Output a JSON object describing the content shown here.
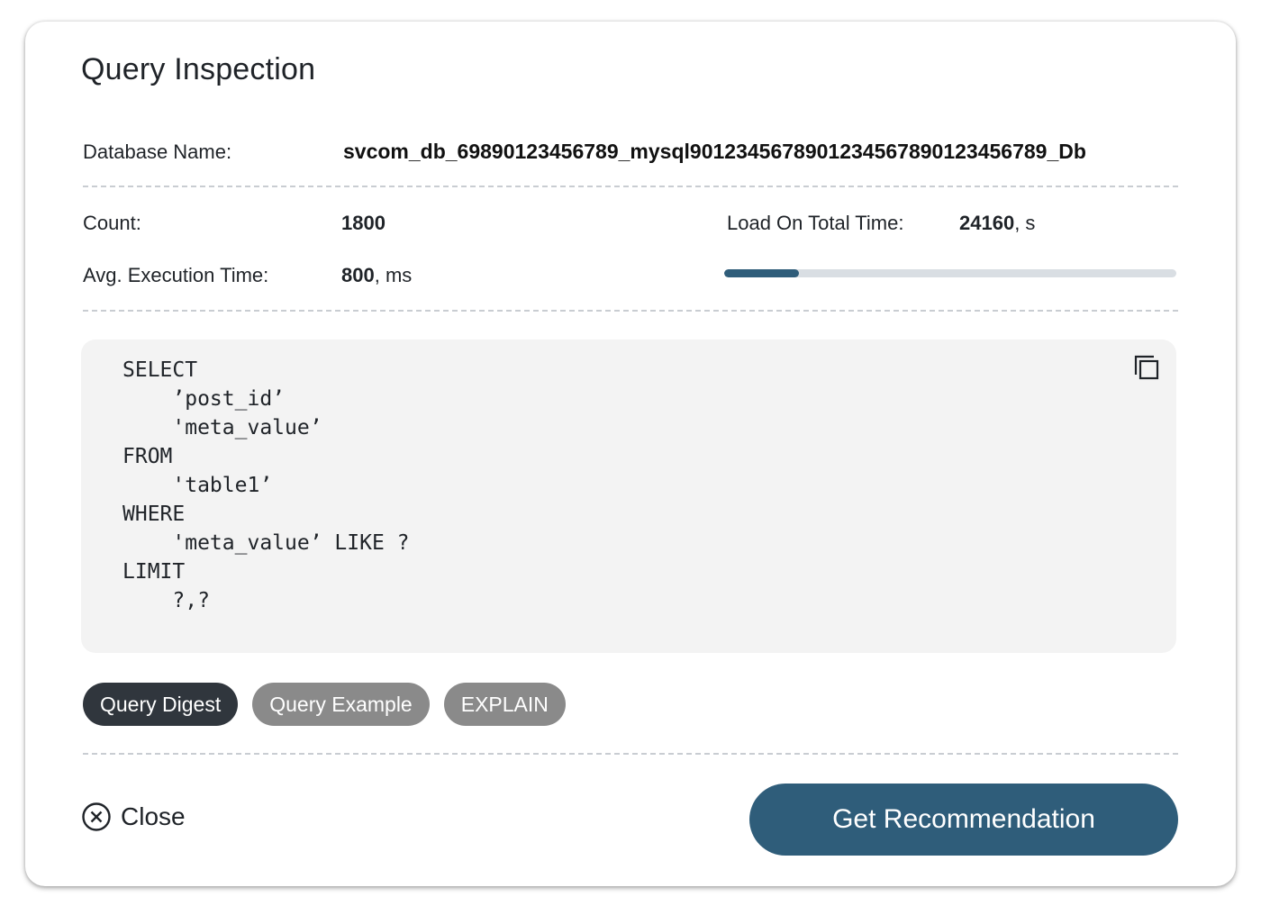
{
  "dialog": {
    "title": "Query Inspection"
  },
  "database": {
    "label": "Database Name:",
    "value": "svcom_db_69890123456789_mysql9012345678901234567890123456789_Db"
  },
  "stats": {
    "count_label": "Count:",
    "count_value": "1800",
    "avg_label": "Avg. Execution Time:",
    "avg_value": "800",
    "avg_unit": ", ms",
    "load_label": "Load On Total Time:",
    "load_value": "24160",
    "load_unit": ", s",
    "load_fraction": 0.165
  },
  "query": {
    "text": "SELECT\n    ’post_id’\n    'meta_value’\nFROM\n    'table1’\nWHERE\n    'meta_value’ LIKE ?\nLIMIT\n    ?,?",
    "copy_icon": "copy-icon"
  },
  "tabs": [
    {
      "label": "Query Digest",
      "active": true
    },
    {
      "label": "Query Example",
      "active": false
    },
    {
      "label": "EXPLAIN",
      "active": false
    }
  ],
  "footer": {
    "close_label": "Close",
    "close_icon": "close-circle-icon",
    "primary_label": "Get Recommendation"
  },
  "colors": {
    "accent": "#2f5d7a",
    "tab_active": "#30363d",
    "tab_inactive": "#8a8a8a",
    "code_bg": "#f3f3f3"
  }
}
